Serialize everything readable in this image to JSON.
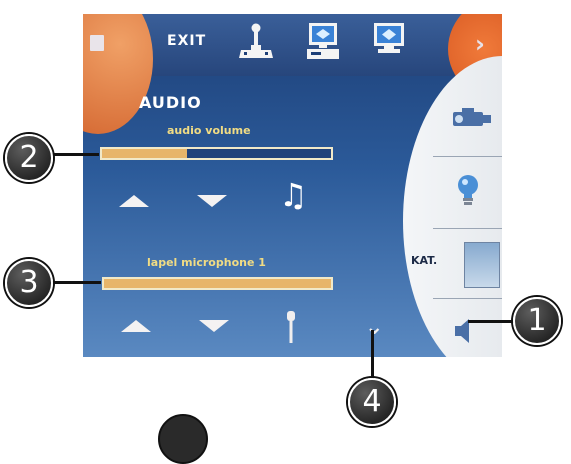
{
  "topbar": {
    "exit_label": "EXIT",
    "icons": [
      "stop-icon",
      "joystick-icon",
      "computer-icon",
      "monitor-icon",
      "chevron-right-icon"
    ]
  },
  "audio": {
    "title": "AUDIO",
    "volume_label": "audio volume",
    "volume_level": 0.37,
    "mic_label": "lapel microphone 1",
    "mic_level": 1.0
  },
  "right_panel": {
    "kat_label": "KAT.",
    "icons": [
      "projector-icon",
      "light-bulb-icon",
      "kat-screen-icon",
      "volume-speaker-icon"
    ]
  },
  "callouts": {
    "c1": "1",
    "c2": "2",
    "c3": "3",
    "c4": "4"
  },
  "colors": {
    "panel_blue": "#2b5a99",
    "accent_orange": "#d1612b",
    "bar_fill": "#e7b56a",
    "label_yellow": "#f1dc84"
  }
}
